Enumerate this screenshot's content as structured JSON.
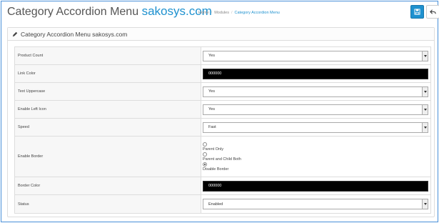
{
  "header": {
    "title_main": "Category Accordion Menu",
    "title_brand": "sakosys.com",
    "breadcrumb": [
      "Home",
      "Modules",
      "Category Accordion Menu"
    ],
    "save_icon": "save-icon",
    "back_icon": "reply-icon"
  },
  "panel": {
    "title": "Category Accordion Menu sakosys.com",
    "icon": "pencil-icon"
  },
  "form": {
    "product_count": {
      "label": "Product Count",
      "value": "Yes"
    },
    "link_color": {
      "label": "Link Color",
      "value": "000000"
    },
    "text_uppercase": {
      "label": "Text Uppercase",
      "value": "Yes"
    },
    "enable_left_icon": {
      "label": "Enable Left Icon",
      "value": "Yes"
    },
    "speed": {
      "label": "Speed",
      "value": "Fast"
    },
    "enable_border": {
      "label": "Enable Border",
      "options": [
        "Parent Only",
        "Parent and Child Both",
        "Disable Border"
      ],
      "selected": "Disable Border"
    },
    "border_color": {
      "label": "Border Color",
      "value": "000000"
    },
    "status": {
      "label": "Status",
      "value": "Enabled"
    }
  },
  "colors": {
    "accent": "#1e91cf",
    "frame": "#4a90d9"
  }
}
